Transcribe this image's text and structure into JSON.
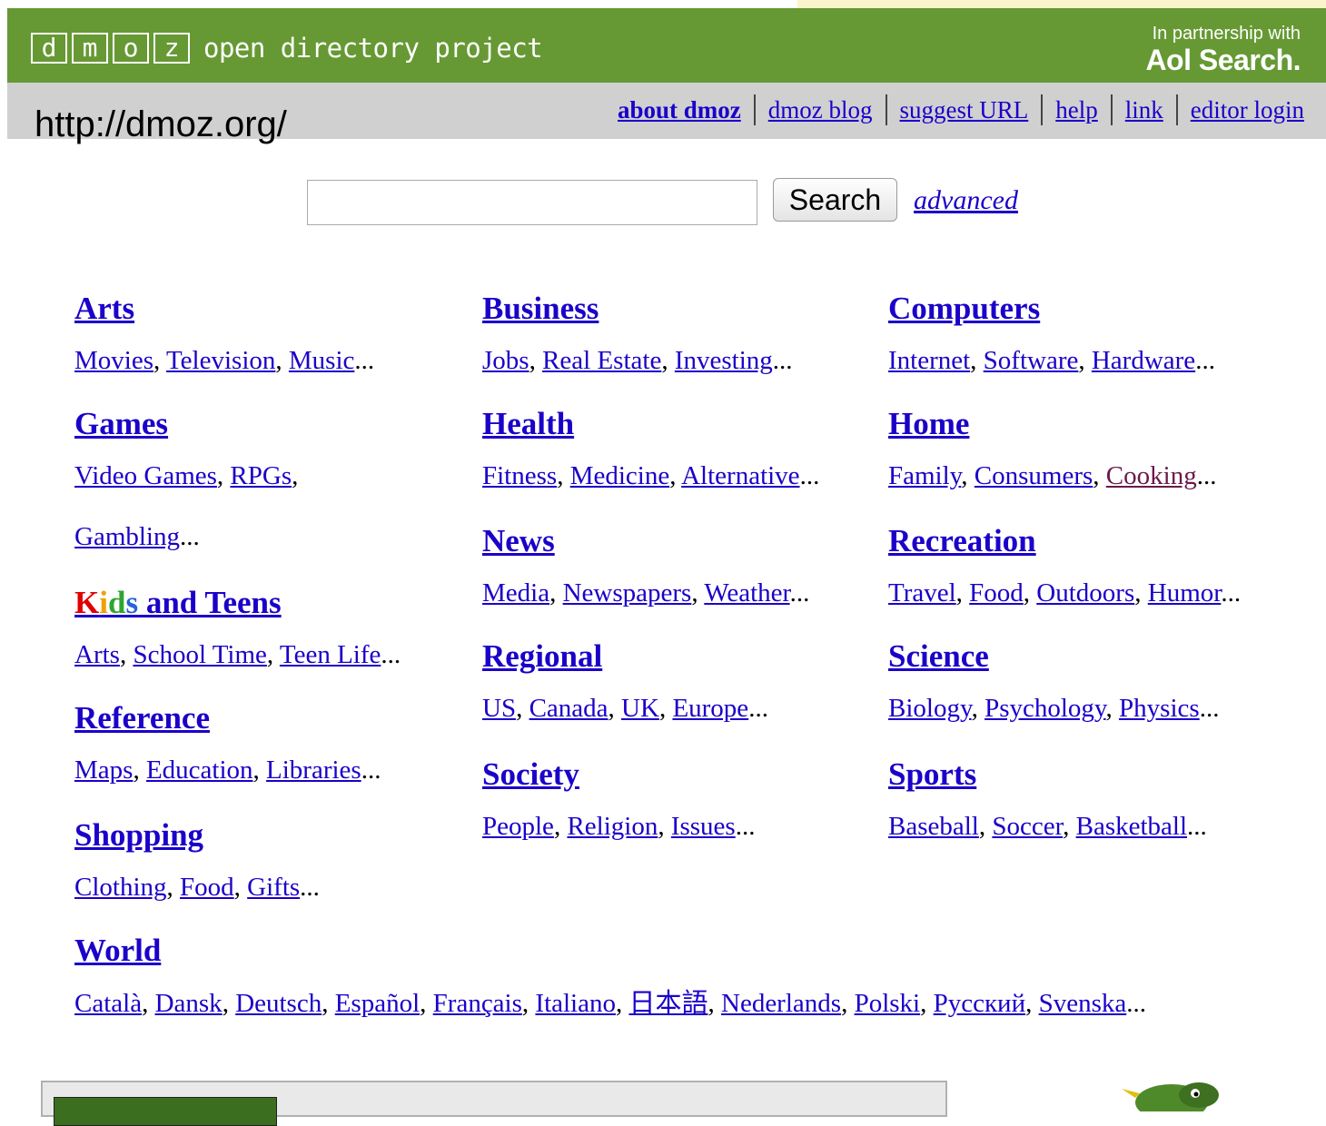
{
  "header": {
    "logo_letters": [
      "d",
      "m",
      "o",
      "z"
    ],
    "logo_text": "open directory project",
    "partner_line1": "In partnership with",
    "partner_line2": "Aol Search."
  },
  "overlay_url": "http://dmoz.org/",
  "nav": {
    "links": [
      "about dmoz",
      "dmoz blog",
      "suggest URL",
      "help",
      "link",
      "editor login"
    ]
  },
  "search": {
    "placeholder": "",
    "button_label": "Search",
    "advanced_label": "advanced"
  },
  "categories": [
    {
      "title": "Arts",
      "subs": [
        "Movies",
        "Television",
        "Music"
      ]
    },
    {
      "title": "Games",
      "subs_line1": [
        "Video Games",
        "RPGs"
      ],
      "subs_line2": [
        "Gambling"
      ]
    },
    {
      "title_parts": [
        "K",
        "i",
        "d",
        "s",
        " and Teens"
      ],
      "subs": [
        "Arts",
        "School Time",
        "Teen Life"
      ]
    },
    {
      "title": "Reference",
      "subs": [
        "Maps",
        "Education",
        "Libraries"
      ]
    },
    {
      "title": "Shopping",
      "subs": [
        "Clothing",
        "Food",
        "Gifts"
      ]
    },
    {
      "title": "Business",
      "subs": [
        "Jobs",
        "Real Estate",
        "Investing"
      ]
    },
    {
      "title": "Health",
      "subs": [
        "Fitness",
        "Medicine",
        "Alternative"
      ]
    },
    {
      "title": "News",
      "subs": [
        "Media",
        "Newspapers",
        "Weather"
      ]
    },
    {
      "title": "Regional",
      "subs": [
        "US",
        "Canada",
        "UK",
        "Europe"
      ]
    },
    {
      "title": "Society",
      "subs": [
        "People",
        "Religion",
        "Issues"
      ]
    },
    {
      "title": "Computers",
      "subs": [
        "Internet",
        "Software",
        "Hardware"
      ]
    },
    {
      "title": "Home",
      "subs": [
        "Family",
        "Consumers",
        "Cooking"
      ]
    },
    {
      "title": "Recreation",
      "subs": [
        "Travel",
        "Food",
        "Outdoors",
        "Humor"
      ]
    },
    {
      "title": "Science",
      "subs": [
        "Biology",
        "Psychology",
        "Physics"
      ]
    },
    {
      "title": "Sports",
      "subs": [
        "Baseball",
        "Soccer",
        "Basketball"
      ]
    },
    {
      "title": "World",
      "subs": [
        "Català",
        "Dansk",
        "Deutsch",
        "Español",
        "Français",
        "Italiano",
        "日本語",
        "Nederlands",
        "Polski",
        "Русский",
        "Svenska"
      ]
    }
  ],
  "punct": {
    "comma": ",",
    "ellipsis": "..."
  },
  "colors": {
    "header_green": "#669933",
    "nav_gray": "#d0d0d0",
    "link_blue": "#1a00c9",
    "visited_purple": "#6b1a4a"
  }
}
